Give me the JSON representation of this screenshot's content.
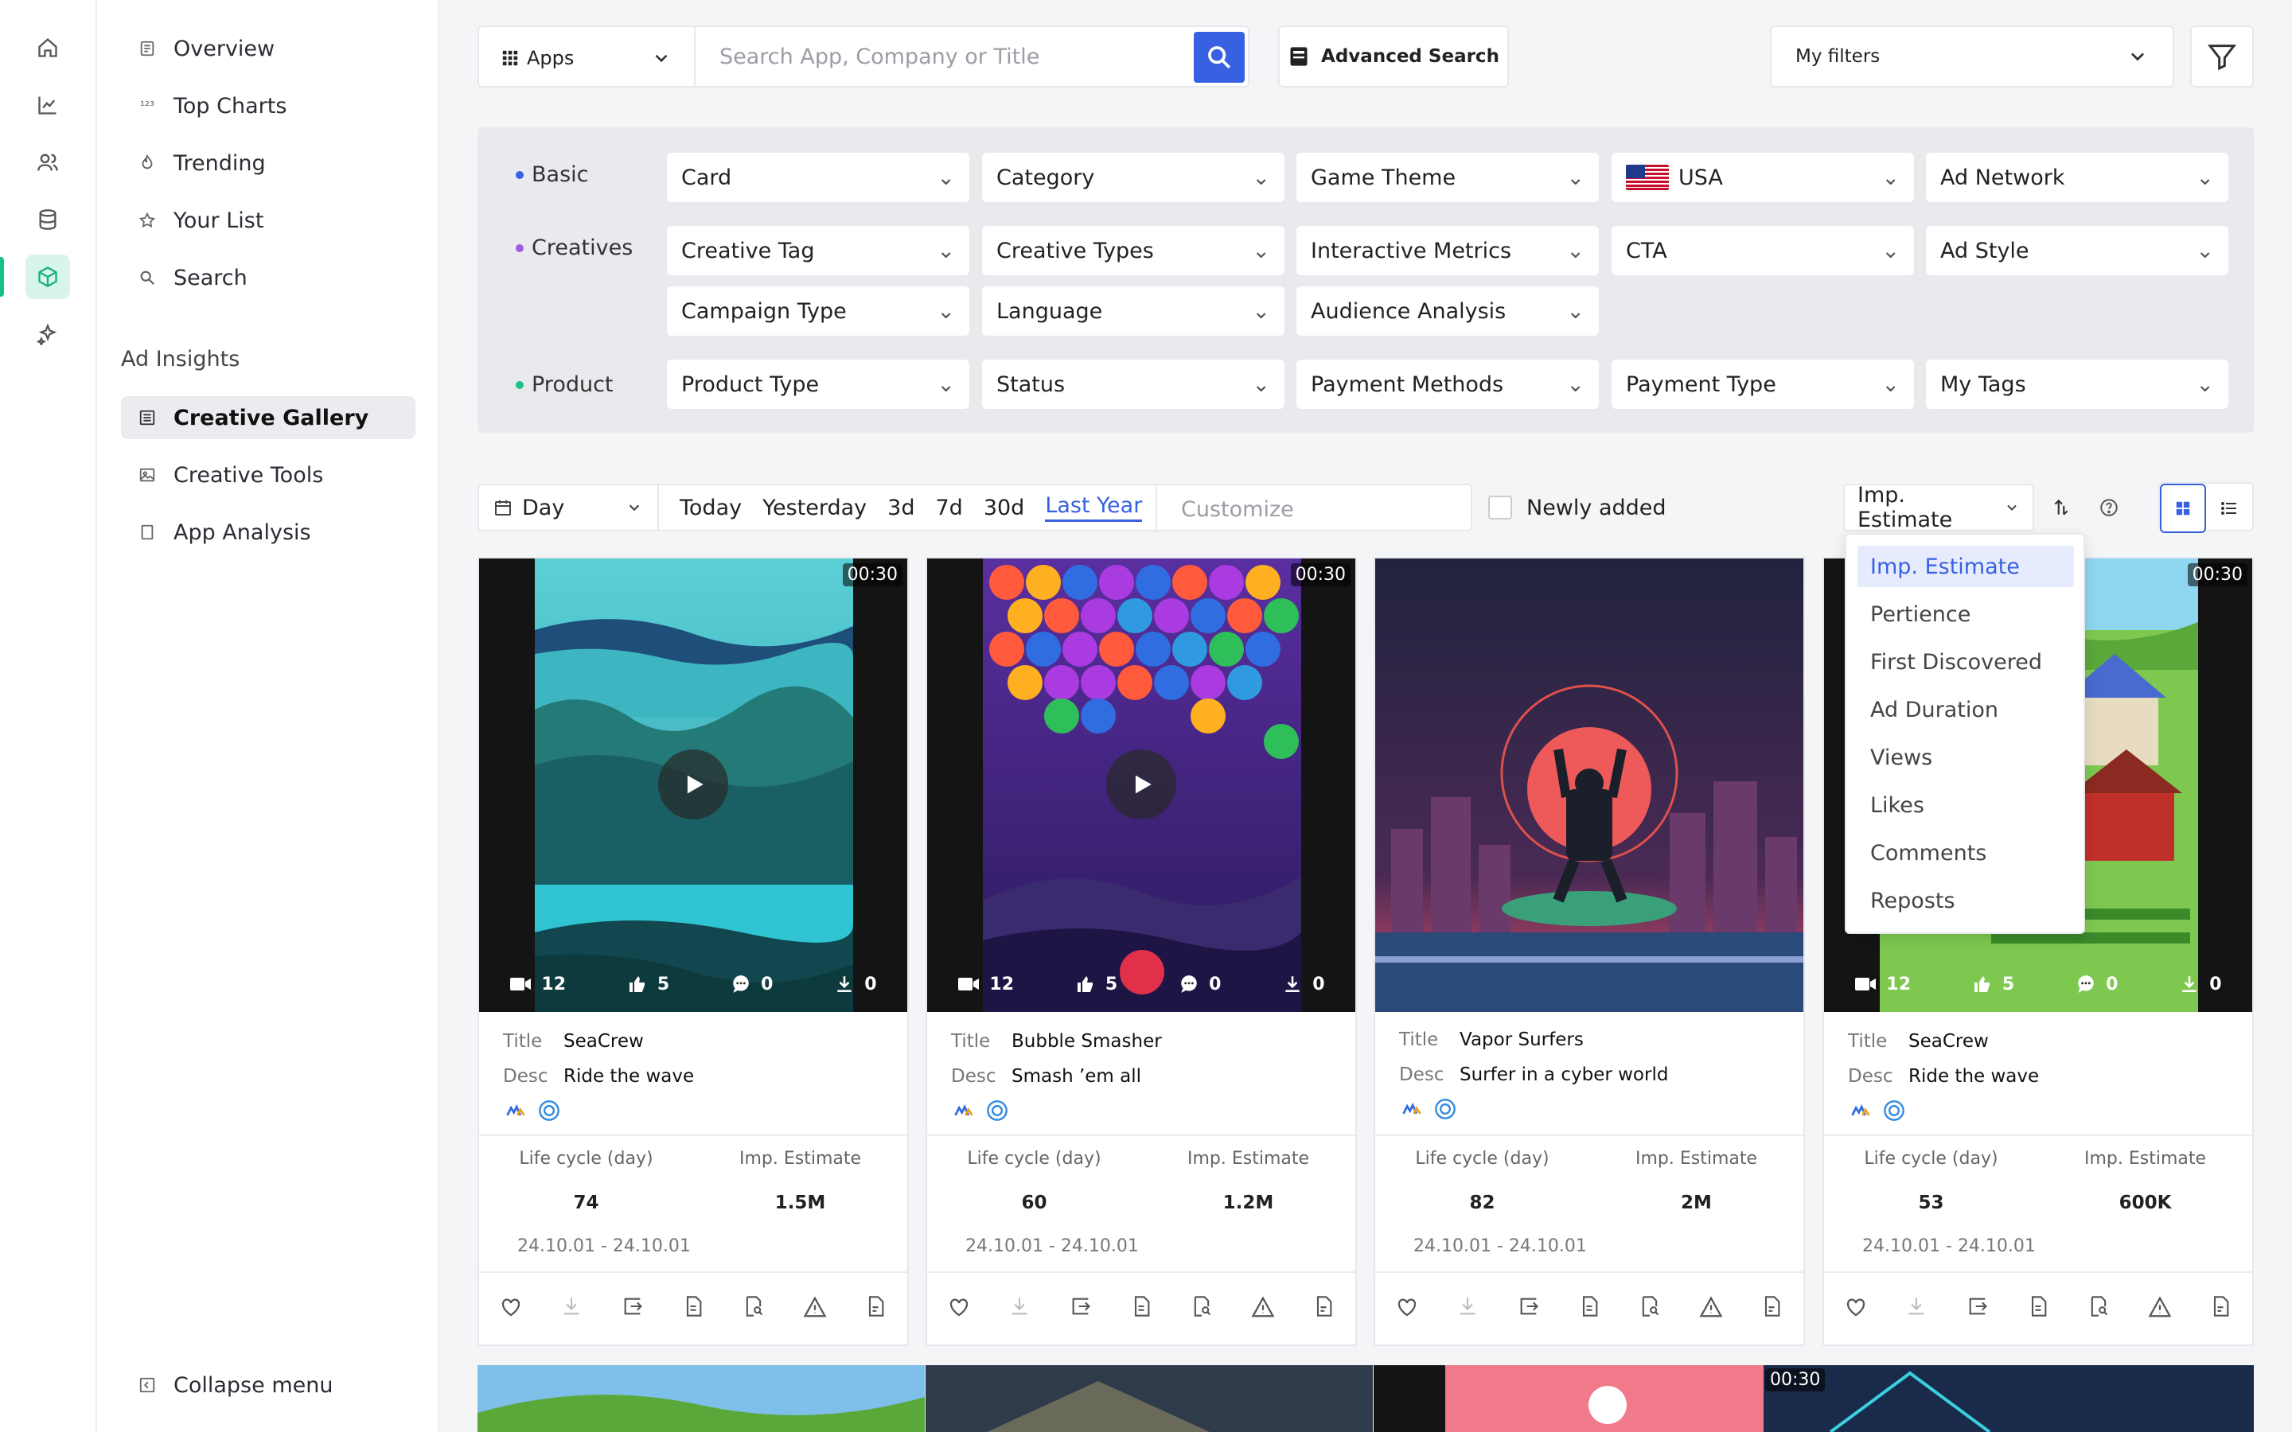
{
  "sidebar": {
    "nav": [
      {
        "label": "Overview",
        "icon": "overview-icon"
      },
      {
        "label": "Top Charts",
        "icon": "top-charts-icon"
      },
      {
        "label": "Trending",
        "icon": "trending-icon"
      },
      {
        "label": "Your List",
        "icon": "star-icon"
      },
      {
        "label": "Search",
        "icon": "search-icon"
      }
    ],
    "section_title": "Ad Insights",
    "insights": [
      {
        "label": "Creative Gallery",
        "icon": "gallery-icon",
        "active": true
      },
      {
        "label": "Creative Tools",
        "icon": "image-icon"
      },
      {
        "label": "App Analysis",
        "icon": "document-icon"
      }
    ],
    "collapse_label": "Collapse menu"
  },
  "topbar": {
    "apps_label": "Apps",
    "search_placeholder": "Search App, Company or Title",
    "advanced_label": "Advanced Search",
    "filters_label": "My filters"
  },
  "filters": {
    "basic_label": "Basic",
    "creatives_label": "Creatives",
    "product_label": "Product",
    "basic": [
      "Card",
      "Category",
      "Game Theme",
      "USA",
      "Ad Network"
    ],
    "creatives_row1": [
      "Creative Tag",
      "Creative Types",
      "Interactive Metrics",
      "CTA",
      "Ad Style"
    ],
    "creatives_row2": [
      "Campaign Type",
      "Language",
      "Audience Analysis"
    ],
    "product": [
      "Product Type",
      "Status",
      "Payment Methods",
      "Payment Type",
      "My Tags"
    ],
    "colors": {
      "basic": "#3761e0",
      "creatives": "#a25ae6",
      "product": "#1fbf85"
    }
  },
  "timebar": {
    "period": "Day",
    "options": [
      "Today",
      "Yesterday",
      "3d",
      "7d",
      "30d",
      "Last Year"
    ],
    "selected": "Last Year",
    "customize": "Customize",
    "newly_added": "Newly added",
    "sort_selected": "Imp. Estimate"
  },
  "sort_menu": [
    "Imp. Estimate",
    "Pertience",
    "First Discovered",
    "Ad Duration",
    "Views",
    "Likes",
    "Comments",
    "Reposts"
  ],
  "cards": [
    {
      "duration": "00:30",
      "videos": "12",
      "likes": "5",
      "comments": "0",
      "downloads": "0",
      "title": "SeaCrew",
      "desc": "Ride the wave",
      "life_cycle": "74",
      "imp": "1.5M",
      "dates": "24.10.01 - 24.10.01",
      "has_video": true
    },
    {
      "duration": "00:30",
      "videos": "12",
      "likes": "5",
      "comments": "0",
      "downloads": "0",
      "title": "Bubble Smasher",
      "desc": "Smash ’em all",
      "life_cycle": "60",
      "imp": "1.2M",
      "dates": "24.10.01 - 24.10.01",
      "has_video": true
    },
    {
      "duration": "",
      "title": "Vapor Surfers",
      "desc": "Surfer in a cyber world",
      "life_cycle": "82",
      "imp": "2M",
      "dates": "24.10.01 - 24.10.01",
      "has_video": false
    },
    {
      "duration": "00:30",
      "videos": "12",
      "likes": "5",
      "comments": "0",
      "downloads": "0",
      "title": "SeaCrew",
      "desc": "Ride the wave",
      "life_cycle": "53",
      "imp": "600K",
      "dates": "24.10.01 - 24.10.01",
      "has_video": true
    }
  ],
  "card_labels": {
    "title": "Title",
    "desc": "Desc",
    "life_cycle": "Life cycle (day)",
    "imp": "Imp. Estimate"
  },
  "bottom_duration": "00:30"
}
